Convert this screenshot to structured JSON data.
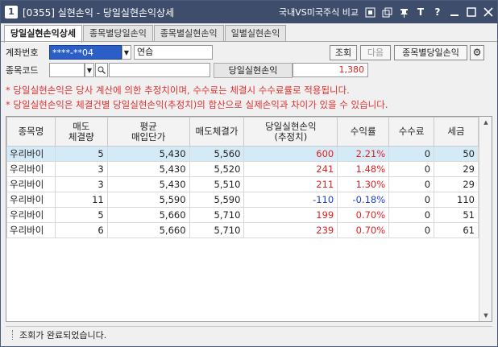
{
  "titlebar": {
    "number": "1",
    "title": "[0355] 실현손익 - 당일실현손익상세",
    "compare_label": "국내VS미국주식 비교"
  },
  "tabs": [
    "당일실현손익상세",
    "종목별당일손익",
    "종목별실현손익",
    "일별실현손익"
  ],
  "form": {
    "account_label": "계좌번호",
    "account_value": "****-**04",
    "account_name": "연습",
    "stock_label": "종목코드",
    "stock_value": "",
    "stock_name": "",
    "query_button": "조회",
    "next_button": "다음",
    "by_stock_button": "종목별당일손익",
    "realized_label": "당일실현손익",
    "realized_value": "1,380"
  },
  "notices": [
    "* 당일실현손익은 당사 계산에 의한 추정치이며, 수수료는 체결시 수수료률로 적용됩니다.",
    "* 당일실현손익은 체결건별 당일실현손익(추정치)의 합산으로 실제손익과 차이가 있을 수 있습니다."
  ],
  "table": {
    "headers": [
      "종목명",
      "매도\n체결량",
      "평균\n매입단가",
      "매도체결가",
      "당일실현손익\n(추정치)",
      "수익률",
      "수수료",
      "세금"
    ],
    "rows": [
      [
        "우리바이",
        "5",
        "5,430",
        "5,560",
        "600",
        "2.21%",
        "0",
        "50"
      ],
      [
        "우리바이",
        "3",
        "5,430",
        "5,520",
        "241",
        "1.48%",
        "0",
        "29"
      ],
      [
        "우리바이",
        "3",
        "5,430",
        "5,510",
        "211",
        "1.30%",
        "0",
        "29"
      ],
      [
        "우리바이",
        "11",
        "5,590",
        "5,590",
        "-110",
        "-0.18%",
        "0",
        "110"
      ],
      [
        "우리바이",
        "5",
        "5,660",
        "5,710",
        "199",
        "0.70%",
        "0",
        "51"
      ],
      [
        "우리바이",
        "6",
        "5,660",
        "5,710",
        "239",
        "0.70%",
        "0",
        "61"
      ]
    ]
  },
  "status": "조회가 완료되었습니다.",
  "colors": {
    "profit": "#e02020",
    "loss": "#1f3fd0",
    "titlebar": "#3d4d6b",
    "selected_row": "#d4ebf7"
  }
}
